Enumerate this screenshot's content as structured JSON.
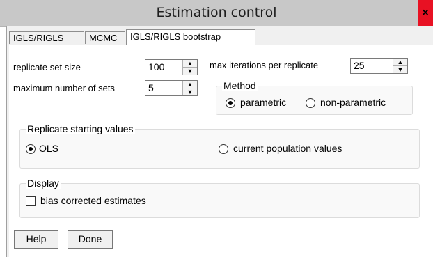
{
  "window": {
    "title": "Estimation control",
    "close_glyph": "×"
  },
  "tabs": [
    {
      "label": "IGLS/RIGLS",
      "active": false
    },
    {
      "label": "MCMC",
      "active": false
    },
    {
      "label": "IGLS/RIGLS bootstrap",
      "active": true
    }
  ],
  "form": {
    "replicate_set_size": {
      "label": "replicate set size",
      "value": "100"
    },
    "max_sets": {
      "label": "maximum number of sets",
      "value": "5"
    },
    "max_iterations": {
      "label": "max iterations per replicate",
      "value": "25"
    },
    "spin_up": "▲",
    "spin_down": "▼"
  },
  "method": {
    "title": "Method",
    "options": [
      {
        "label": "parametric",
        "checked": true
      },
      {
        "label": "non-parametric",
        "checked": false
      }
    ]
  },
  "starting_values": {
    "title": "Replicate starting values",
    "options": [
      {
        "label": "OLS",
        "checked": true
      },
      {
        "label": "current population values",
        "checked": false
      }
    ]
  },
  "display": {
    "title": "Display",
    "bias_corrected": {
      "label": "bias corrected estimates",
      "checked": false
    }
  },
  "buttons": {
    "help": "Help",
    "done": "Done"
  }
}
